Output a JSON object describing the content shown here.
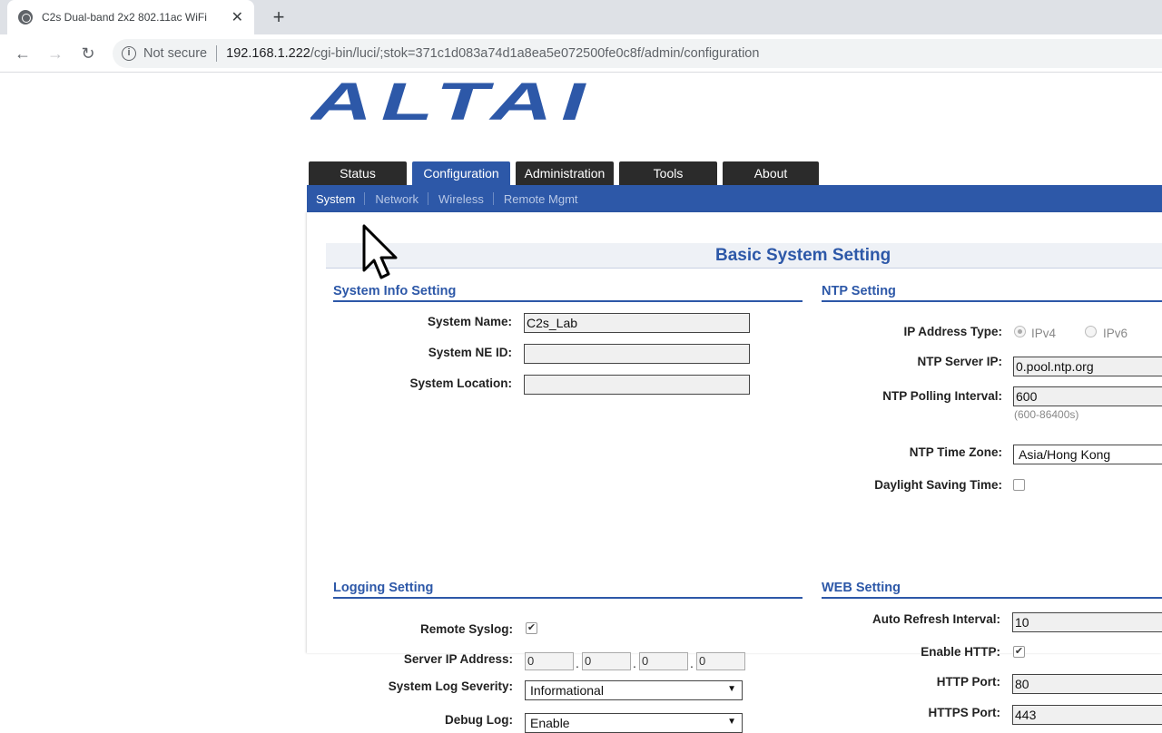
{
  "browser": {
    "tab_title": "C2s Dual-band 2x2 802.11ac WiFi",
    "tab_close": "✕",
    "new_tab": "+",
    "back": "←",
    "forward": "→",
    "reload": "↻",
    "security_label": "Not secure",
    "url_host": "192.168.1.222",
    "url_path": "/cgi-bin/luci/;stok=371c1d083a74d1a8ea5e072500fe0c8f/admin/configuration"
  },
  "logo_text": "ALTAI",
  "colors": {
    "brand_blue": "#2d58a8",
    "tab_dark": "#2b2b2b"
  },
  "main_tabs": [
    {
      "label": "Status"
    },
    {
      "label": "Configuration",
      "active": true
    },
    {
      "label": "Administration"
    },
    {
      "label": "Tools"
    },
    {
      "label": "About"
    }
  ],
  "sub_nav": [
    {
      "label": "System",
      "active": true
    },
    {
      "label": "Network"
    },
    {
      "label": "Wireless"
    },
    {
      "label": "Remote Mgmt"
    }
  ],
  "page_title": "Basic System Setting",
  "system_info": {
    "title": "System Info Setting",
    "name_label": "System Name:",
    "name_value": "C2s_Lab",
    "ne_id_label": "System NE ID:",
    "ne_id_value": "",
    "location_label": "System Location:",
    "location_value": ""
  },
  "ntp": {
    "title": "NTP Setting",
    "ip_type_label": "IP Address Type:",
    "ipv4_label": "IPv4",
    "ipv6_label": "IPv6",
    "ip_type_selected": "IPv4",
    "server_label": "NTP Server IP:",
    "server_value": "0.pool.ntp.org",
    "interval_label": "NTP Polling Interval:",
    "interval_value": "600",
    "interval_hint": "(600-86400s)",
    "timezone_label": "NTP Time Zone:",
    "timezone_value": "Asia/Hong Kong",
    "dst_label": "Daylight Saving Time:",
    "dst_checked": false
  },
  "logging": {
    "title": "Logging Setting",
    "remote_syslog_label": "Remote Syslog:",
    "remote_syslog_checked": true,
    "server_ip_label": "Server IP Address:",
    "server_ip": [
      "0",
      "0",
      "0",
      "0"
    ],
    "ip_separator": ".",
    "severity_label": "System Log Severity:",
    "severity_value": "Informational",
    "debug_label": "Debug Log:",
    "debug_value": "Enable"
  },
  "web": {
    "title": "WEB Setting",
    "refresh_label": "Auto Refresh Interval:",
    "refresh_value": "10",
    "http_label": "Enable HTTP:",
    "http_checked": true,
    "http_port_label": "HTTP Port:",
    "http_port_value": "80",
    "https_port_label": "HTTPS Port:",
    "https_port_value": "443"
  },
  "check_glyph": "✔",
  "dropdown_glyph": "▼"
}
